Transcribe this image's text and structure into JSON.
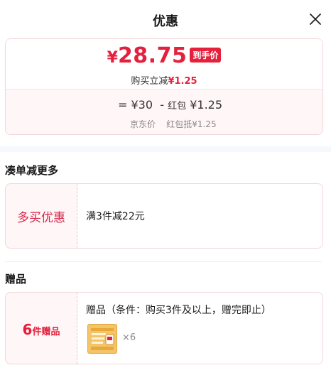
{
  "header": {
    "title": "优惠"
  },
  "price": {
    "currency": "¥",
    "final_amount": "28.75",
    "badge": "到手价",
    "reduce_label": "购买立减",
    "reduce_amount": "¥1.25",
    "formula": {
      "eq": "=",
      "base": "¥30",
      "minus": "-",
      "redpack_label": "红包",
      "redpack_amount": "¥1.25"
    },
    "labels": {
      "jd_price": "京东价",
      "redpack_offset": "红包抵¥1.25"
    }
  },
  "bundle": {
    "section_title": "凑单减更多",
    "left_label": "多买优惠",
    "detail": "满3件减22元"
  },
  "gift": {
    "section_title": "赠品",
    "count_num": "6",
    "count_text": "件赠品",
    "condition": "赠品（条件：购买3件及以上，赠完即止）",
    "qty": "×6"
  },
  "colors": {
    "accent": "#e4203c",
    "card_bg": "#fff6f7",
    "border": "#f3d6d9"
  }
}
